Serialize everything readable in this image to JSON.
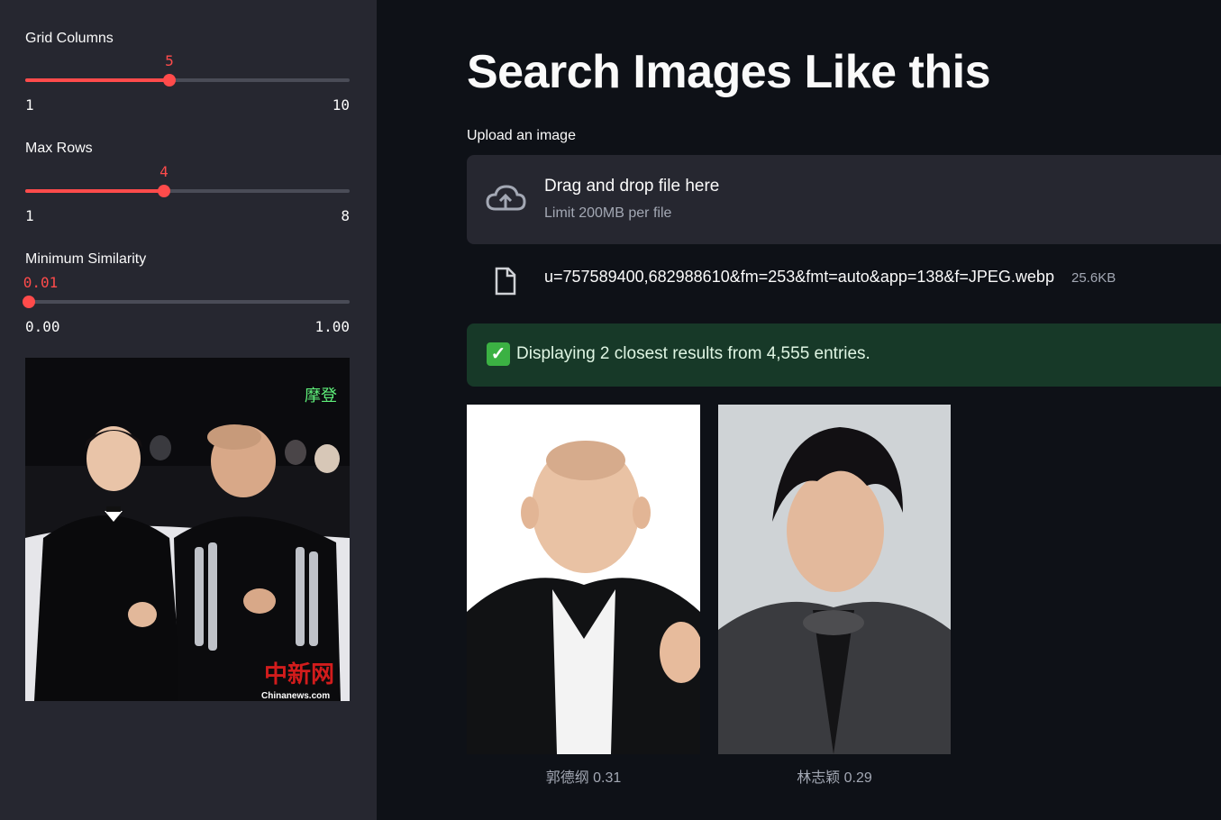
{
  "sidebar": {
    "sliders": [
      {
        "label": "Grid Columns",
        "value": "5",
        "min": "1",
        "max": "10",
        "fraction": 0.444
      },
      {
        "label": "Max Rows",
        "value": "4",
        "min": "1",
        "max": "8",
        "fraction": 0.429
      },
      {
        "label": "Minimum Similarity",
        "value": "0.01",
        "min": "0.00",
        "max": "1.00",
        "fraction": 0.01
      }
    ],
    "preview_watermark": "中新网",
    "preview_caption": "Chinanews.com",
    "preview_corner_text": "摩登"
  },
  "main": {
    "title": "Search Images Like this",
    "upload_label": "Upload an image",
    "dropzone": {
      "title": "Drag and drop file here",
      "subtitle": "Limit 200MB per file",
      "icon": "cloud-upload-icon"
    },
    "file": {
      "name": "u=757589400,682988610&fm=253&fmt=auto&app=138&f=JPEG.webp",
      "size": "25.6KB",
      "icon": "file-icon"
    },
    "alert": {
      "text": "Displaying 2 closest results from 4,555 entries.",
      "icon": "check-icon"
    },
    "results": [
      {
        "caption": "郭德纲 0.31"
      },
      {
        "caption": "林志颖 0.29"
      }
    ]
  },
  "colors": {
    "accent": "#ff4b4b",
    "background": "#0e1117",
    "sidebar": "#262730",
    "success_bg": "#173928"
  }
}
